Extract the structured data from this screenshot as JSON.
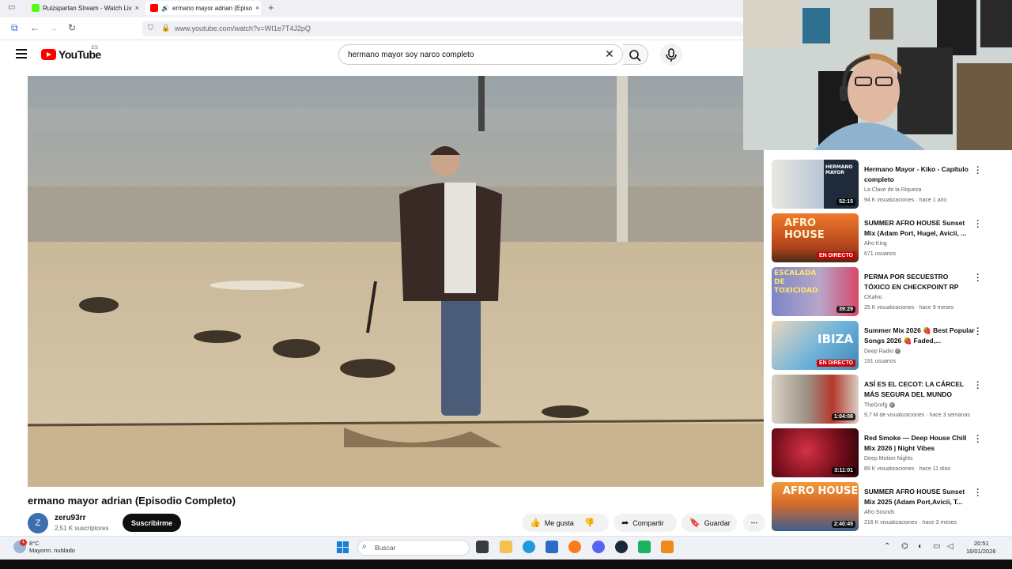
{
  "browser": {
    "tabs": [
      {
        "label": "Ruizspartan Stream - Watch Liv",
        "favicon_color": "#53fc18"
      },
      {
        "label": "ermano mayor adrian (Episo",
        "favicon_color": "#ff0000",
        "active": true
      }
    ],
    "new_tab": "+",
    "close": "×",
    "url": "www.youtube.com/watch?v=WI1e7T4J2pQ"
  },
  "youtube": {
    "logo": "YouTube",
    "region": "ES",
    "search_query": "hermano mayor soy narco completo",
    "clear": "✕"
  },
  "video": {
    "title": "ermano mayor adrian (Episodio Completo)",
    "channel": {
      "avatar_letter": "Z",
      "name": "zeru93rr",
      "subscribers": "2,51 K suscriptores"
    },
    "subscribe_label": "Suscribirme",
    "actions": {
      "like": "Me gusta",
      "share": "Compartir",
      "save": "Guardar"
    }
  },
  "recommendations": [
    {
      "title": "Hermano Mayor - Kiko - Capítulo completo",
      "channel": "La Clave de la Riqueza",
      "verified": false,
      "meta": "94 K visualizaciones · hace 1 año",
      "duration": "52:15",
      "live": false,
      "thumb_text": "HERMANO MAYOR",
      "colors": [
        "#e9e6df",
        "#b8c6d3"
      ]
    },
    {
      "title": "SUMMER AFRO HOUSE Sunset Mix (Adam Port, Hugel, Avicii, ...",
      "channel": "Afro King",
      "verified": false,
      "meta": "671 usuarios",
      "duration": "",
      "live": true,
      "live_label": "EN DIRECTO",
      "thumb_text": "AFRO HOUSE",
      "colors": [
        "#f07a2c",
        "#7a3b1e"
      ]
    },
    {
      "title": "PERMA POR SECUESTRO TÓXICO EN CHECKPOINT RP",
      "channel": "CKalvo",
      "verified": false,
      "meta": "25 K visualizaciones · hace 9 meses",
      "duration": "39:29",
      "live": false,
      "thumb_text": "ESCALADA DE TOXICIDAD",
      "colors": [
        "#6b6fb0",
        "#d54a6a"
      ]
    },
    {
      "title": "Summer Mix 2026 🍓 Best Popular Songs 2026 🍓 Faded,...",
      "channel": "Deep Radio",
      "verified": true,
      "meta": "191 usuarios",
      "duration": "",
      "live": true,
      "live_label": "EN DIRECTO",
      "thumb_text": "IBIZA",
      "colors": [
        "#6fb3d9",
        "#e5b98b"
      ]
    },
    {
      "title": "ASÍ ES EL CECOT: LA CÁRCEL MÁS SEGURA DEL MUNDO",
      "channel": "TheGrefg",
      "verified": true,
      "meta": "9,7 M de visualizaciones · hace 3 semanas",
      "duration": "1:04:08",
      "live": false,
      "thumb_text": "",
      "colors": [
        "#c9c2b5",
        "#b33a2c"
      ]
    },
    {
      "title": "Red Smoke — Deep House Chill Mix 2026 | Night Vibes",
      "channel": "Deep Motion Nights",
      "verified": false,
      "meta": "89 K visualizaciones · hace 11 días",
      "duration": "3:11:01",
      "live": false,
      "thumb_text": "",
      "colors": [
        "#5a0c12",
        "#c0293a"
      ]
    },
    {
      "title": "SUMMER AFRO HOUSE Sunset Mix 2025 (Adam Port,Avicii, T...",
      "channel": "Afro Sounds",
      "verified": false,
      "meta": "216 K visualizaciones · hace 3 meses",
      "duration": "2:40:45",
      "live": false,
      "thumb_text": "AFRO HOUSE",
      "colors": [
        "#f29a3c",
        "#3b5f8f"
      ]
    }
  ],
  "taskbar": {
    "weather": {
      "temp": "8°C",
      "desc": "Mayorm. nublado",
      "badge": "1"
    },
    "search_placeholder": "Buscar",
    "time": "20:51",
    "date": "16/01/2026"
  }
}
